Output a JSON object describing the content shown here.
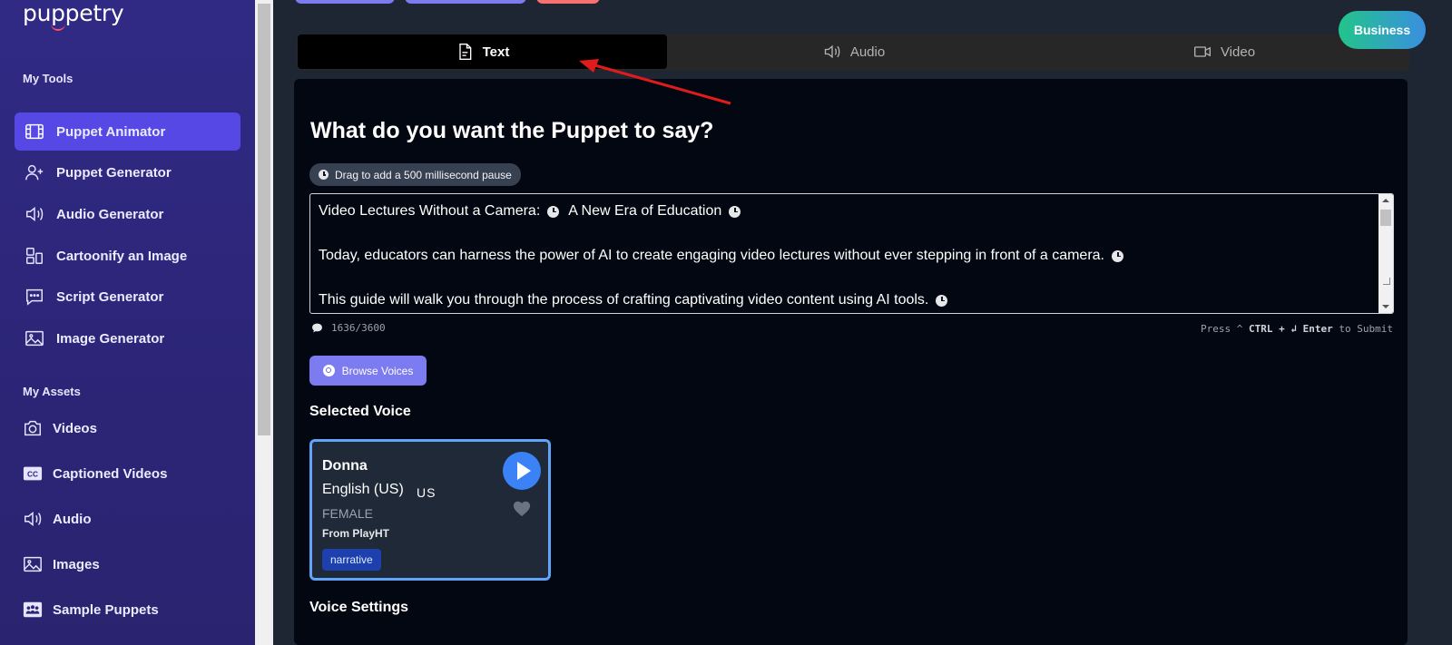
{
  "app": {
    "logo_text": "puppetry"
  },
  "sidebar": {
    "tools_heading": "My Tools",
    "tools": [
      {
        "label": "Puppet Animator",
        "icon": "film-icon",
        "active": true
      },
      {
        "label": "Puppet Generator",
        "icon": "user-plus-icon"
      },
      {
        "label": "Audio Generator",
        "icon": "speaker-icon"
      },
      {
        "label": "Cartoonify an Image",
        "icon": "layout-icon"
      },
      {
        "label": "Script Generator",
        "icon": "chat-icon"
      },
      {
        "label": "Image Generator",
        "icon": "image-icon"
      }
    ],
    "assets_heading": "My Assets",
    "assets": [
      {
        "label": "Videos",
        "icon": "camera-icon"
      },
      {
        "label": "Captioned Videos",
        "icon": "cc-icon"
      },
      {
        "label": "Audio",
        "icon": "speaker-icon"
      },
      {
        "label": "Images",
        "icon": "image-icon"
      },
      {
        "label": "Sample Puppets",
        "icon": "group-icon"
      }
    ]
  },
  "tabs": [
    {
      "label": "Text",
      "icon": "document-icon",
      "active": true
    },
    {
      "label": "Audio",
      "icon": "speaker-icon"
    },
    {
      "label": "Video",
      "icon": "video-camera-icon"
    }
  ],
  "business_button": "Business",
  "main": {
    "heading": "What do you want the Puppet to say?",
    "pause_chip": "Drag to add a 500 millisecond pause",
    "script_lines": [
      "Video Lectures Without a Camera:",
      "A New Era of Education",
      "Today, educators can harness the power of AI to create engaging video lectures without ever stepping in front of a camera.",
      "This guide will walk you through the process of crafting captivating video content using AI tools."
    ],
    "char_count": "1636/3600",
    "submit_hint_prefix": "Press ^",
    "submit_hint_ctrl": "CTRL",
    "submit_hint_plus": "+ ↲",
    "submit_hint_enter": "Enter",
    "submit_hint_suffix": "to Submit",
    "browse_voices": "Browse Voices",
    "selected_voice_label": "Selected Voice",
    "voice_settings_label": "Voice Settings"
  },
  "voice": {
    "name": "Donna",
    "language": "English (US)",
    "country_code": "US",
    "gender": "FEMALE",
    "source": "From PlayHT",
    "tag": "narrative"
  },
  "colors": {
    "sidebar_bg": "#302a85",
    "active_nav": "#5548e4",
    "panel_bg": "#030712",
    "accent_blue": "#3b82f6",
    "annotation_arrow": "#e01b1b"
  }
}
